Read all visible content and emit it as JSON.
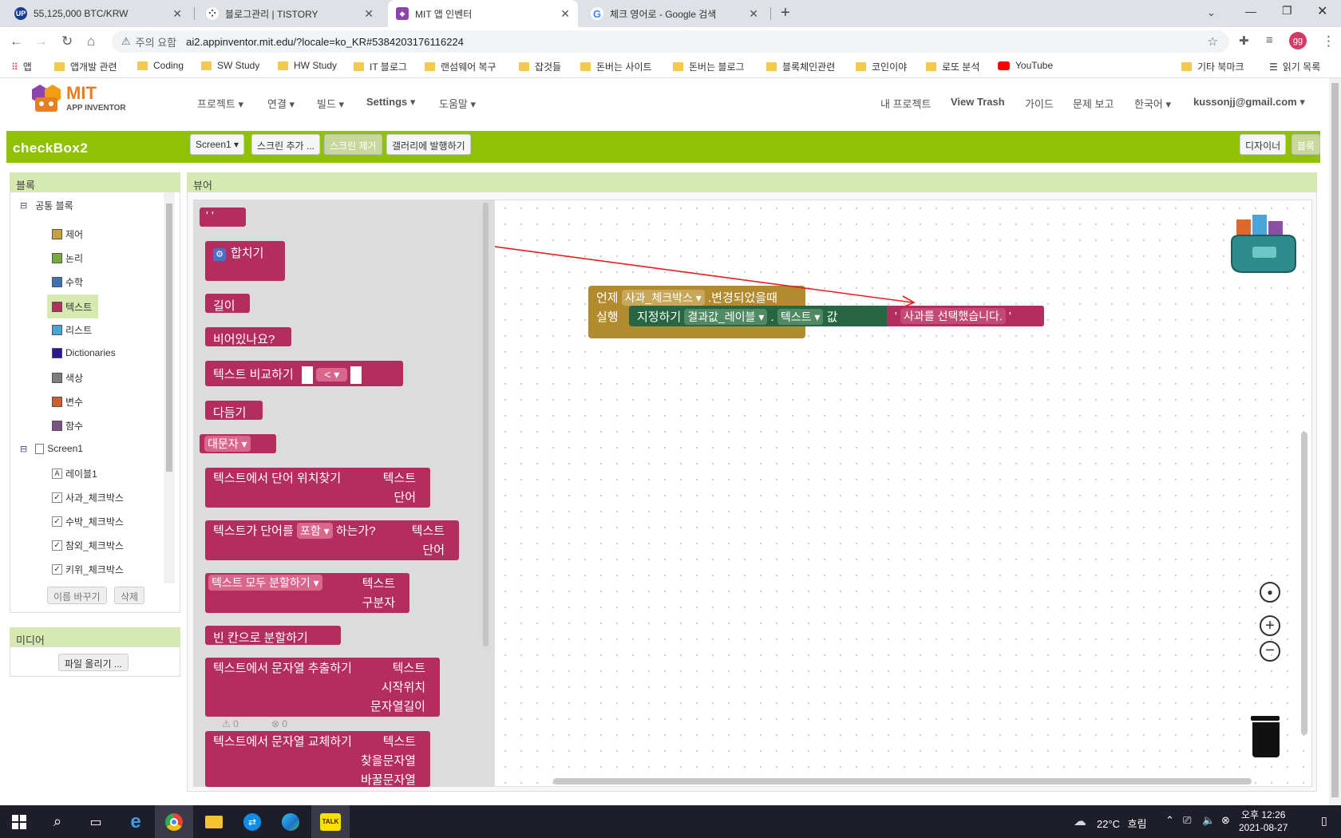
{
  "browser": {
    "tabs": [
      {
        "title": "55,125,000 BTC/KRW",
        "favicon": "up-icon",
        "color": "#1a3c8f"
      },
      {
        "title": "블로그관리 | TISTORY",
        "favicon": "tistory-icon",
        "color": "#333333"
      },
      {
        "title": "MIT 앱 인벤터",
        "favicon": "appinventor-icon",
        "color": "#8e44ad",
        "active": true
      },
      {
        "title": "체크 영어로 - Google 검색",
        "favicon": "google-icon",
        "color": "#4285f4"
      }
    ],
    "new_tab": "+",
    "security": "주의 요함",
    "url": "ai2.appinventor.mit.edu/?locale=ko_KR#5384203176116224",
    "profile": "gg",
    "bookmarks": [
      "앱",
      "앱개발 관련",
      "Coding",
      "SW Study",
      "HW Study",
      "IT 블로그",
      "랜섬웨어 복구",
      "잡것들",
      "돈버는 사이트",
      "돈버는 블로그",
      "블록체인관련",
      "코인이야",
      "로또 분석",
      "YouTube"
    ],
    "bookmarks_right": [
      "기타 북마크",
      "읽기 목록"
    ]
  },
  "app": {
    "logo_mit": "MIT",
    "logo_sub": "APP INVENTOR",
    "menus": [
      "프로젝트 ▾",
      "연결 ▾",
      "빌드 ▾",
      "Settings ▾",
      "도움말 ▾"
    ],
    "right_menus": [
      "내 프로젝트",
      "View Trash",
      "가이드",
      "문제 보고",
      "한국어 ▾",
      "kussonjj@gmail.com ▾"
    ],
    "project_name": "checkBox2",
    "screen_select": "Screen1 ▾",
    "add_screen": "스크린 추가 ...",
    "remove_screen": "스크린 제거",
    "publish": "갤러리에 발행하기",
    "designer": "디자이너",
    "blocks": "블록"
  },
  "blocks_panel": {
    "header": "블록",
    "built_in": "공통 블록",
    "categories": [
      {
        "label": "제어",
        "color": "#c4a23c"
      },
      {
        "label": "논리",
        "color": "#77ab41"
      },
      {
        "label": "수학",
        "color": "#3f71b5"
      },
      {
        "label": "텍스트",
        "color": "#b32d5e"
      },
      {
        "label": "리스트",
        "color": "#49a6d4"
      },
      {
        "label": "Dictionaries",
        "color": "#2d1799"
      },
      {
        "label": "색상",
        "color": "#7d7d7d"
      },
      {
        "label": "변수",
        "color": "#d05f2d"
      },
      {
        "label": "함수",
        "color": "#7c5385"
      }
    ],
    "screen": "Screen1",
    "components": [
      "레이블1",
      "사과_체크박스",
      "수박_체크박스",
      "참외_체크박스",
      "키위_체크박스"
    ],
    "rename": "이름 바꾸기",
    "delete": "삭제"
  },
  "media": {
    "header": "미디어",
    "upload": "파일 올리기 ..."
  },
  "viewer": {
    "header": "뷰어",
    "warnings": "0",
    "errors": "0"
  },
  "flyout": {
    "empty_text": "' '",
    "join": "합치기",
    "length": "길이",
    "is_empty": "비어있나요?",
    "compare": "텍스트 비교하기",
    "compare_op": "< ▾",
    "trim": "다듬기",
    "upcase": "대문자 ▾",
    "starts_at_1": "텍스트에서 단어 위치찾기",
    "starts_at_2": "텍스트",
    "starts_at_3": "단어",
    "contains_1": "텍스트가 단어를",
    "contains_dd": "포함 ▾",
    "contains_2": "하는가?",
    "contains_3": "텍스트",
    "contains_4": "단어",
    "split_dd": "텍스트 모두 분할하기 ▾",
    "split_2": "텍스트",
    "split_3": "구분자",
    "split_spaces": "빈 칸으로 분할하기",
    "segment_1": "텍스트에서 문자열 추출하기",
    "segment_2": "텍스트",
    "segment_3": "시작위치",
    "segment_4": "문자열길이",
    "replace_1": "텍스트에서 문자열 교체하기",
    "replace_2": "텍스트",
    "replace_3": "찾을문자열",
    "replace_4": "바꿀문자열"
  },
  "workspace": {
    "when": "언제",
    "component": "사과_체크박스 ▾",
    "event": ".변경되었을때",
    "do": "실행",
    "set": "지정하기",
    "target": "결과값_레이블 ▾",
    "dot": ".",
    "property": "텍스트 ▾",
    "to": "값",
    "text_value": "사과를 선택했습니다.",
    "quote_open": "'",
    "quote_close": "'"
  },
  "taskbar": {
    "temperature": "22°C",
    "weather": "흐림",
    "time": "오후 12:26",
    "date": "2021-08-27"
  }
}
